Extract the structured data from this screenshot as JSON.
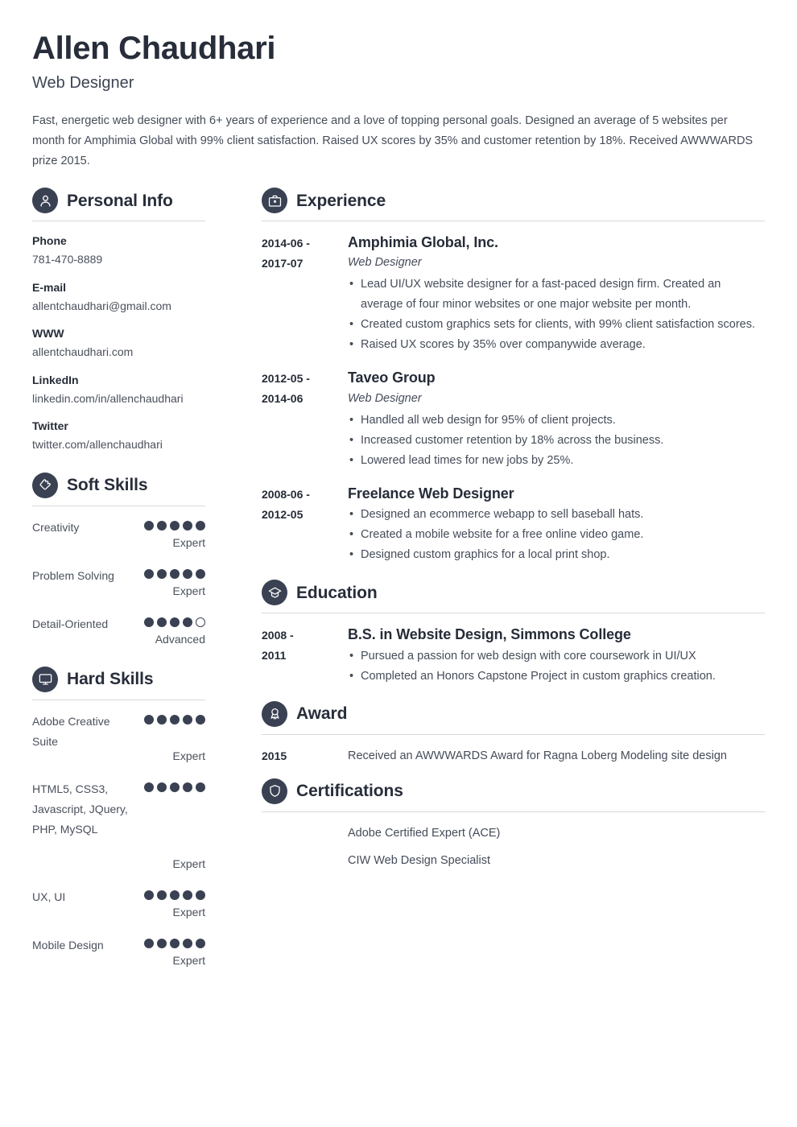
{
  "header": {
    "name": "Allen Chaudhari",
    "job_title": "Web Designer",
    "summary": "Fast, energetic web designer with 6+ years of experience and a love of topping personal goals. Designed an average of 5 websites per month for Amphimia Global with 99% client satisfaction. Raised UX scores by 35% and customer retention by 18%. Received AWWWARDS prize 2015."
  },
  "colors": {
    "accent_dark": "#3a4152",
    "heading": "#272d3a",
    "body_text": "#454c59",
    "rule": "#d8d8d8",
    "background": "#ffffff"
  },
  "left": {
    "personal_info": {
      "title": "Personal Info",
      "icon": "user-icon",
      "items": [
        {
          "label": "Phone",
          "value": "781-470-8889"
        },
        {
          "label": "E-mail",
          "value": "allentchaudhari@gmail.com"
        },
        {
          "label": "WWW",
          "value": "allentchaudhari.com"
        },
        {
          "label": "LinkedIn",
          "value": "linkedin.com/in/allenchaudhari"
        },
        {
          "label": "Twitter",
          "value": "twitter.com/allenchaudhari"
        }
      ]
    },
    "soft_skills": {
      "title": "Soft Skills",
      "icon": "puzzle-piece-icon",
      "max_rating": 5,
      "items": [
        {
          "name": "Creativity",
          "rating": 5,
          "level": "Expert"
        },
        {
          "name": "Problem Solving",
          "rating": 5,
          "level": "Expert"
        },
        {
          "name": "Detail-Oriented",
          "rating": 4,
          "level": "Advanced"
        }
      ]
    },
    "hard_skills": {
      "title": "Hard Skills",
      "icon": "monitor-icon",
      "max_rating": 5,
      "items": [
        {
          "name": "Adobe Creative Suite",
          "rating": 5,
          "level": "Expert"
        },
        {
          "name": "HTML5, CSS3, Javascript, JQuery, PHP, MySQL",
          "rating": 5,
          "level": "Expert"
        },
        {
          "name": "UX, UI",
          "rating": 5,
          "level": "Expert"
        },
        {
          "name": "Mobile Design",
          "rating": 5,
          "level": "Expert"
        }
      ]
    }
  },
  "right": {
    "experience": {
      "title": "Experience",
      "icon": "briefcase-icon",
      "entries": [
        {
          "date": "2014-06 - 2017-07",
          "date_line1": "2014-06 -",
          "date_line2": "2017-07",
          "org": "Amphimia Global, Inc.",
          "role": "Web Designer",
          "bullets": [
            "Lead UI/UX website designer for a fast-paced design firm. Created an average of four minor websites or one major website per month.",
            "Created custom graphics sets for clients, with 99% client satisfaction scores.",
            "Raised UX scores by 35% over companywide average."
          ]
        },
        {
          "date": "2012-05 - 2014-06",
          "date_line1": "2012-05 -",
          "date_line2": "2014-06",
          "org": "Taveo Group",
          "role": "Web Designer",
          "bullets": [
            "Handled all web design for 95% of client projects.",
            "Increased customer retention by 18% across the business.",
            "Lowered lead times for new jobs by 25%."
          ]
        },
        {
          "date": "2008-06 - 2012-05",
          "date_line1": "2008-06 -",
          "date_line2": "2012-05",
          "org": "Freelance Web Designer",
          "role": "",
          "bullets": [
            "Designed an ecommerce webapp to sell baseball hats.",
            "Created a mobile website for a free online video game.",
            "Designed custom graphics for a local print shop."
          ]
        }
      ]
    },
    "education": {
      "title": "Education",
      "icon": "graduation-cap-icon",
      "entries": [
        {
          "date": "2008 - 2011",
          "date_line1": "2008 -",
          "date_line2": "2011",
          "org": "B.S. in Website Design, Simmons College",
          "role": "",
          "bullets": [
            "Pursued a passion for web design with core coursework in UI/UX",
            "Completed an Honors Capstone Project in custom graphics creation."
          ]
        }
      ]
    },
    "award": {
      "title": "Award",
      "icon": "award-medal-icon",
      "entries": [
        {
          "date": "2015",
          "text": "Received an AWWWARDS Award for Ragna Loberg Modeling site design"
        }
      ]
    },
    "certifications": {
      "title": "Certifications",
      "icon": "shield-icon",
      "entries": [
        {
          "date": "",
          "text": "Adobe Certified Expert (ACE)"
        },
        {
          "date": "",
          "text": "CIW Web Design Specialist"
        }
      ]
    }
  }
}
